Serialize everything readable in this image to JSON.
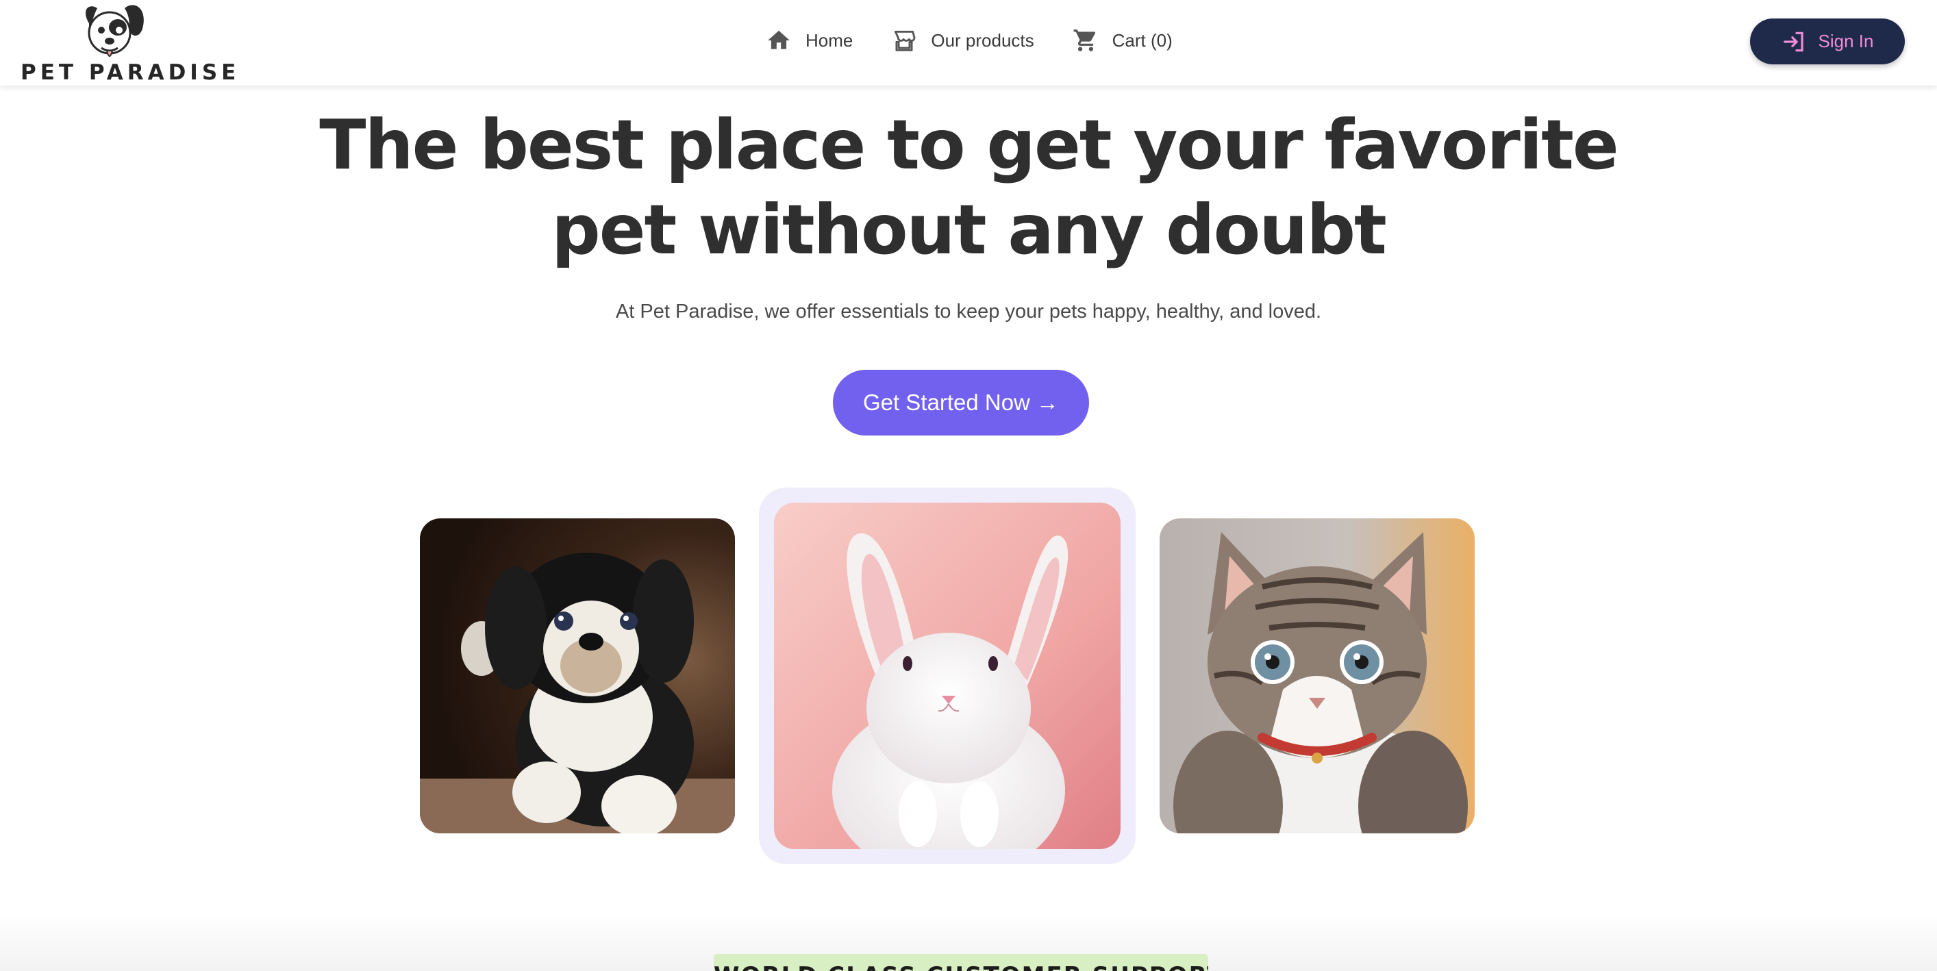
{
  "brand": {
    "name": "PET PARADISE",
    "logo_icon": "dog-face-icon"
  },
  "nav": {
    "links": [
      {
        "label": "Home",
        "icon": "home-icon"
      },
      {
        "label": "Our products",
        "icon": "storefront-icon"
      },
      {
        "label": "Cart (0)",
        "icon": "cart-icon"
      }
    ],
    "signin": {
      "label": "Sign In",
      "icon": "login-icon"
    }
  },
  "hero": {
    "title_line1": "The best place to get your favorite",
    "title_line2": "pet without any doubt",
    "subtitle": "At Pet Paradise, we offer essentials to keep your pets happy, healthy, and loved.",
    "cta": "Get Started Now →"
  },
  "pets": [
    {
      "name": "puppy-photo",
      "animal": "dog"
    },
    {
      "name": "bunny-photo",
      "animal": "rabbit",
      "highlighted": true
    },
    {
      "name": "kitten-photo",
      "animal": "cat"
    }
  ],
  "section_badge": "WORLD CLASS CUSTOMER SUPPORT",
  "colors": {
    "primary": "#7260ef",
    "signin_bg": "#1f2a4a",
    "signin_text": "#f08bd8",
    "highlight_frame": "#efedfc",
    "badge_bg": "#d8efc4"
  }
}
